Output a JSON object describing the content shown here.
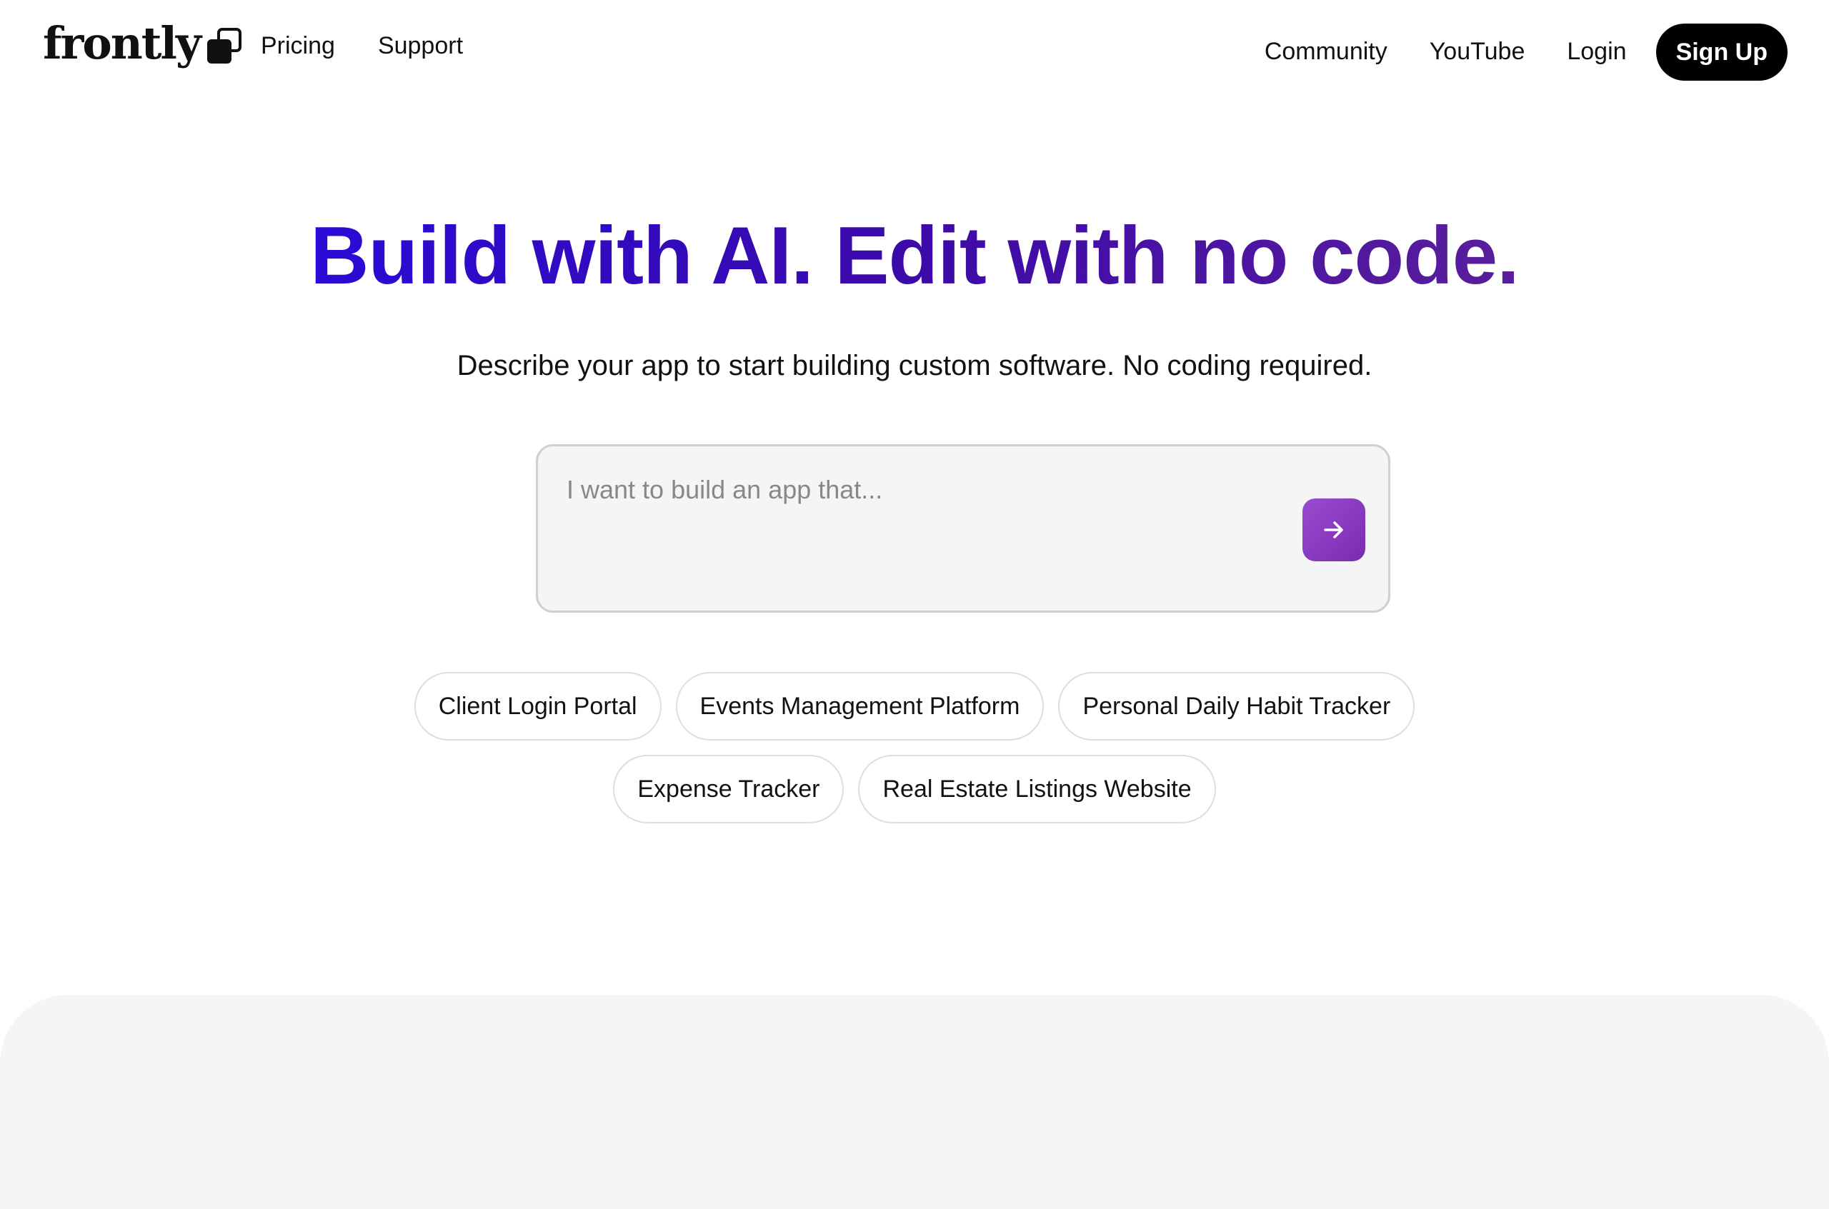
{
  "header": {
    "logo_text": "frontly",
    "nav_left": [
      {
        "label": "Pricing"
      },
      {
        "label": "Support"
      }
    ],
    "nav_right": [
      {
        "label": "Community"
      },
      {
        "label": "YouTube"
      },
      {
        "label": "Login"
      }
    ],
    "signup_label": "Sign Up"
  },
  "hero": {
    "title": "Build with AI. Edit with no code.",
    "subtitle": "Describe your app to start building custom software. No coding required."
  },
  "prompt": {
    "value": "",
    "placeholder": "I want to build an app that...",
    "submit_icon": "arrow-right-icon"
  },
  "suggestions": {
    "row1": [
      "Client Login Portal",
      "Events Management Platform",
      "Personal Daily Habit Tracker"
    ],
    "row2": [
      "Expense Tracker",
      "Real Estate Listings Website"
    ]
  },
  "colors": {
    "title_gradient_start": "#2a0ad6",
    "title_gradient_end": "#5a1e9c",
    "submit_button": "#8a3cc4",
    "signup_button": "#000000"
  }
}
